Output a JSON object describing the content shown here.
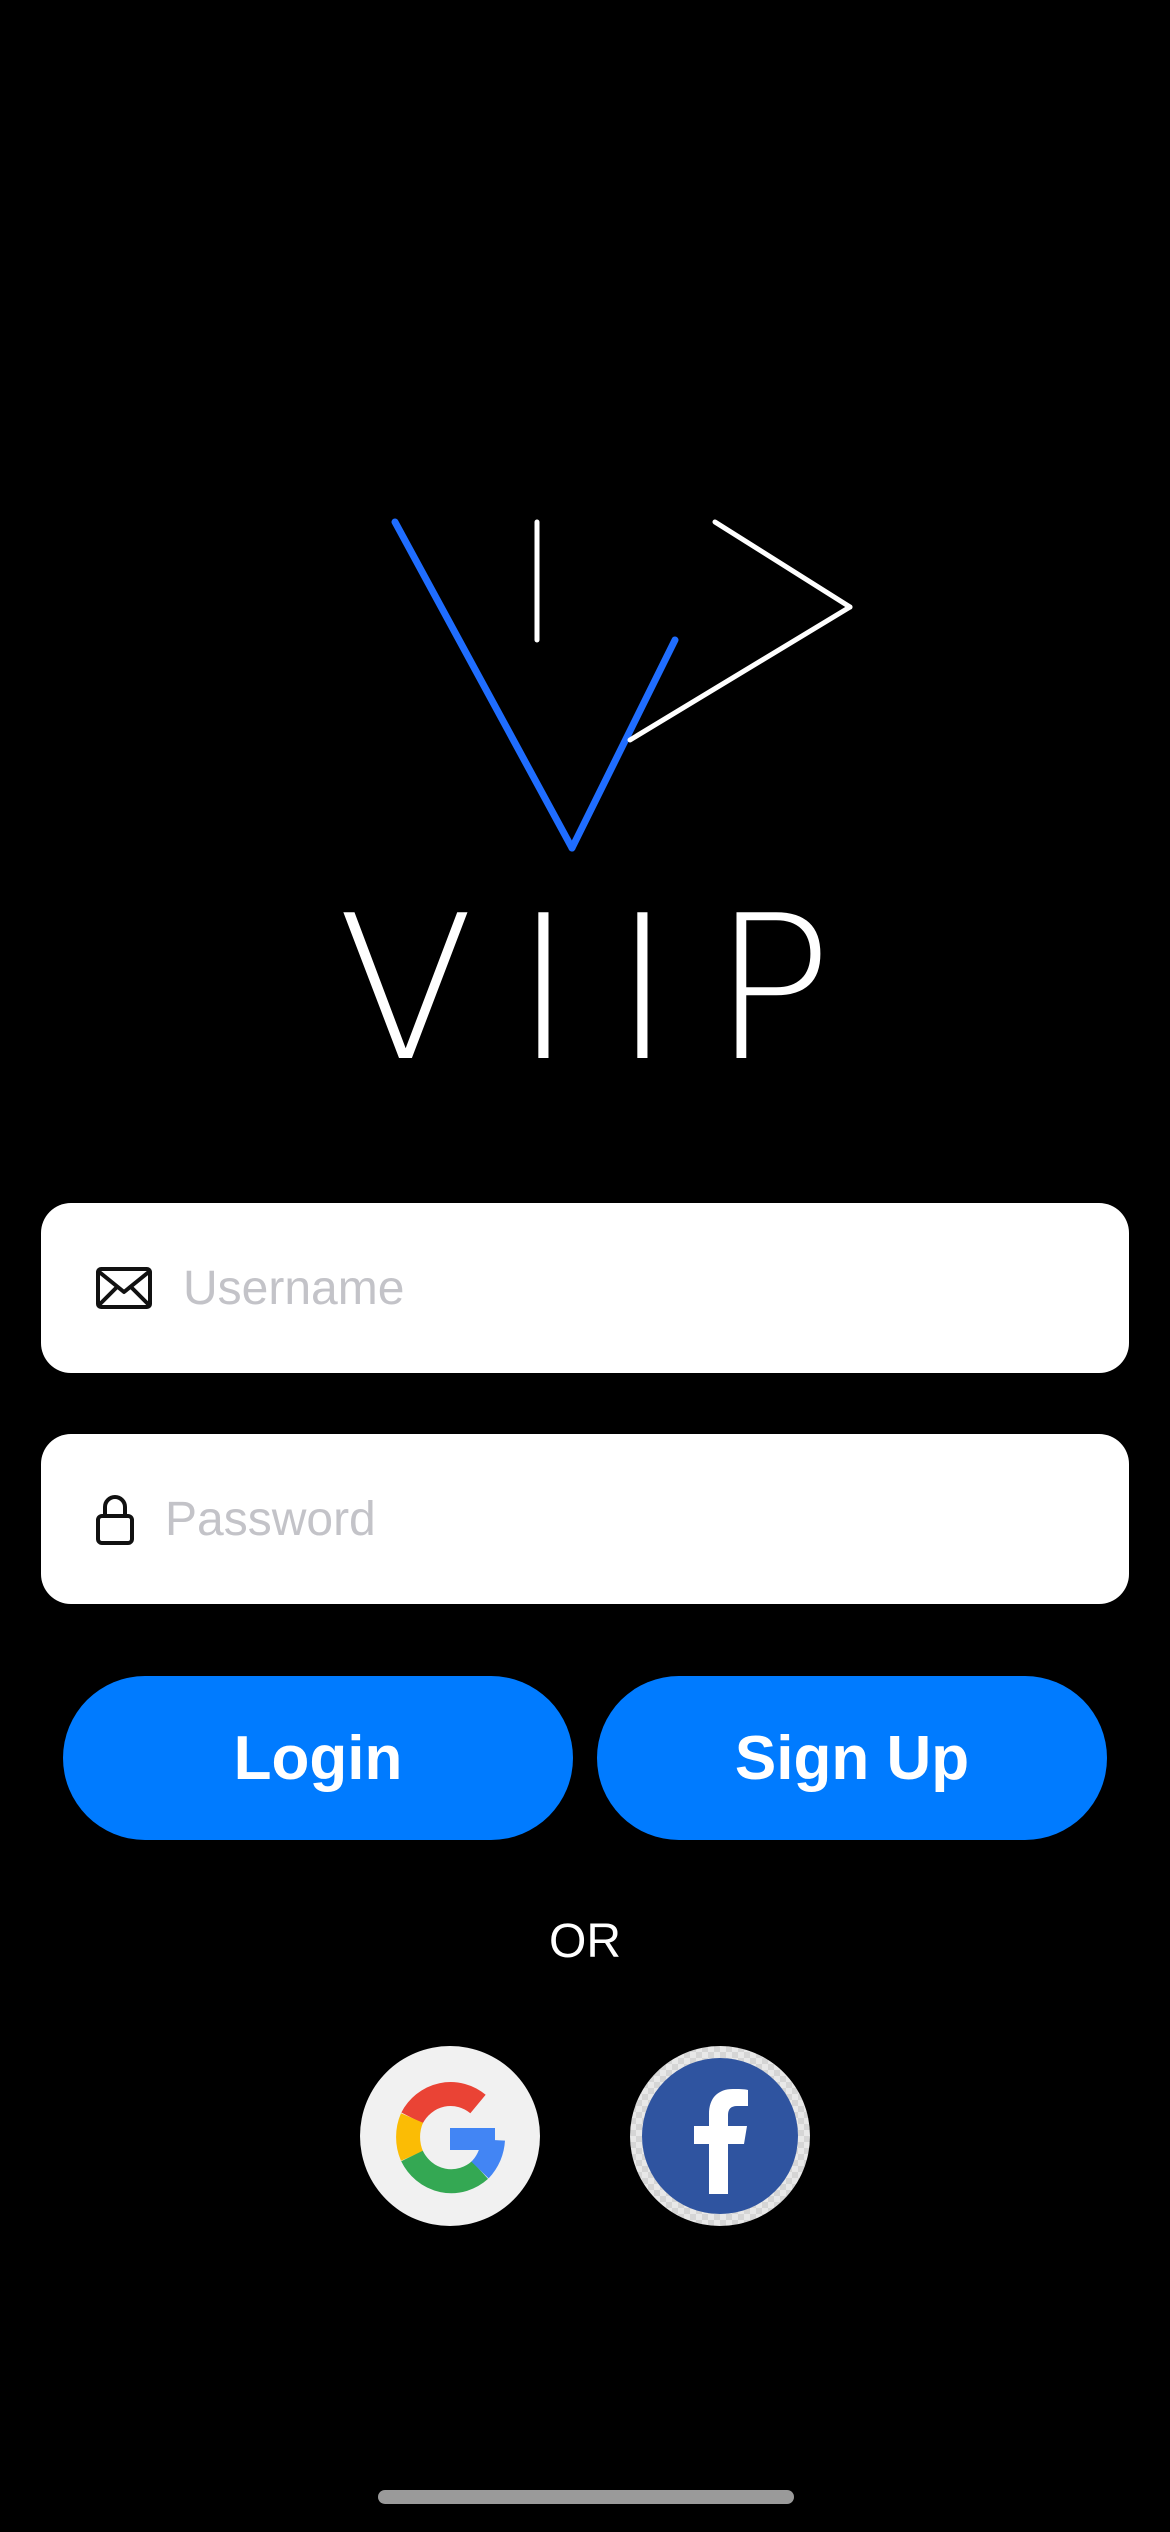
{
  "logo": {
    "wordmark": "VIIP",
    "mark_icon": "viip-logo-mark"
  },
  "username": {
    "placeholder": "Username",
    "value": "",
    "icon": "envelope-icon"
  },
  "password": {
    "placeholder": "Password",
    "value": "",
    "icon": "lock-icon"
  },
  "buttons": {
    "login_label": "Login",
    "signup_label": "Sign Up"
  },
  "divider_text": "OR",
  "social": {
    "google_icon": "google-icon",
    "facebook_icon": "facebook-icon"
  },
  "colors": {
    "background": "#000000",
    "accent": "#007bff",
    "logo_blue": "#1f6dff",
    "field_background": "#ffffff",
    "placeholder": "#c3c3c8",
    "facebook_blue": "#3b5998"
  }
}
